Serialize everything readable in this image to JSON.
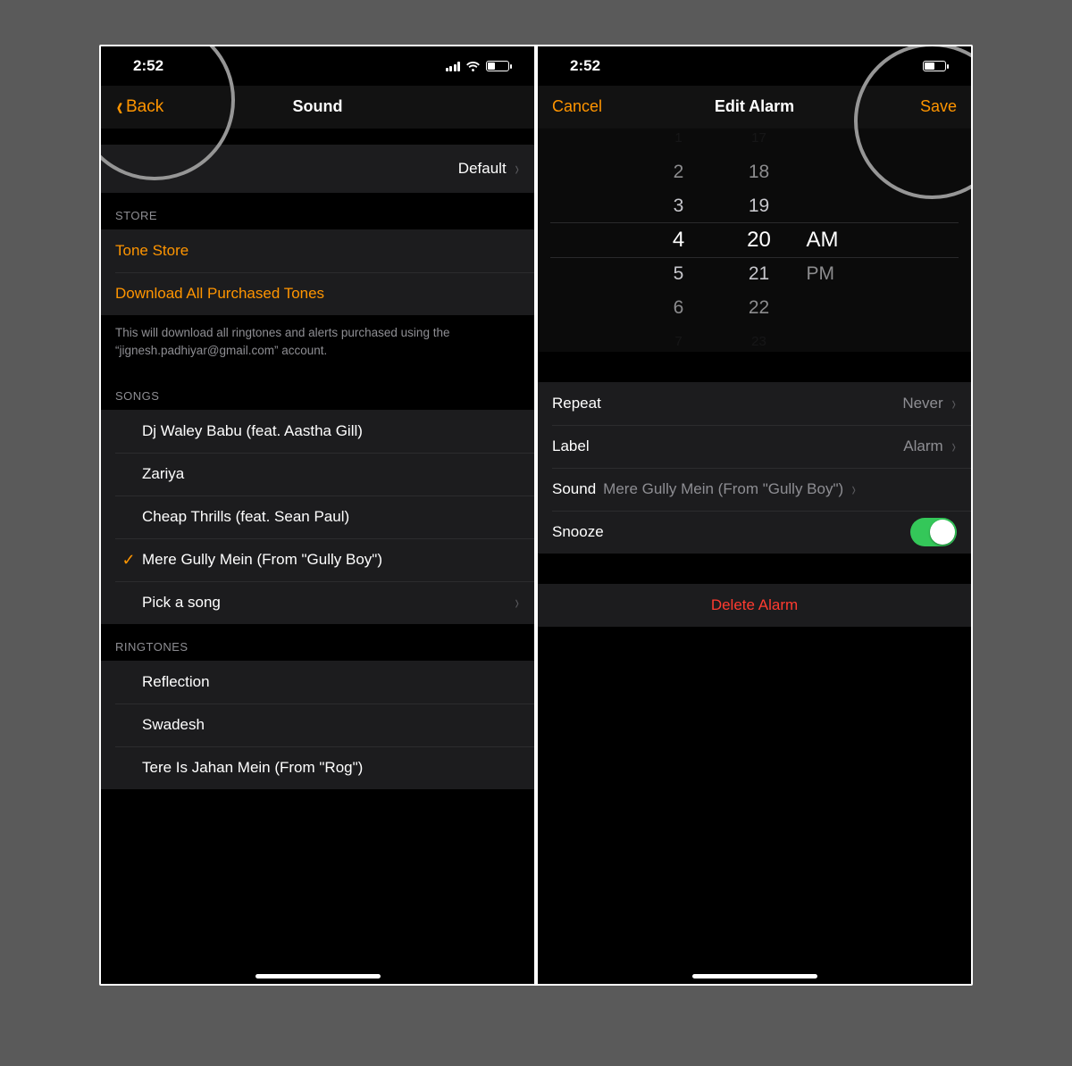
{
  "status": {
    "time": "2:52"
  },
  "left": {
    "back_label": "Back",
    "title": "Sound",
    "default_label": "Default",
    "store_header": "STORE",
    "tone_store": "Tone Store",
    "download_all": "Download All Purchased Tones",
    "download_footer": "This will download all ringtones and alerts purchased using the “jignesh.padhiyar@gmail.com” account.",
    "songs_header": "SONGS",
    "songs": [
      "Dj Waley Babu (feat. Aastha Gill)",
      "Zariya",
      "Cheap Thrills (feat. Sean Paul)",
      "Mere Gully Mein (From \"Gully Boy\")"
    ],
    "selected_song_index": 3,
    "pick_song": "Pick a song",
    "ringtones_header": "RINGTONES",
    "ringtones": [
      "Reflection",
      "Swadesh",
      "Tere Is Jahan Mein (From \"Rog\")"
    ]
  },
  "right": {
    "cancel": "Cancel",
    "title": "Edit Alarm",
    "save": "Save",
    "picker": {
      "hours": [
        "1",
        "2",
        "3",
        "4",
        "5",
        "6",
        "7"
      ],
      "minutes": [
        "17",
        "18",
        "19",
        "20",
        "21",
        "22",
        "23"
      ],
      "ampm": [
        "AM",
        "PM"
      ],
      "selected_hour": "4",
      "selected_minute": "20",
      "selected_ampm": "AM"
    },
    "rows": {
      "repeat_label": "Repeat",
      "repeat_value": "Never",
      "label_label": "Label",
      "label_value": "Alarm",
      "sound_label": "Sound",
      "sound_value": "Mere Gully Mein (From \"Gully Boy\")",
      "snooze_label": "Snooze",
      "snooze_on": true
    },
    "delete": "Delete Alarm"
  }
}
